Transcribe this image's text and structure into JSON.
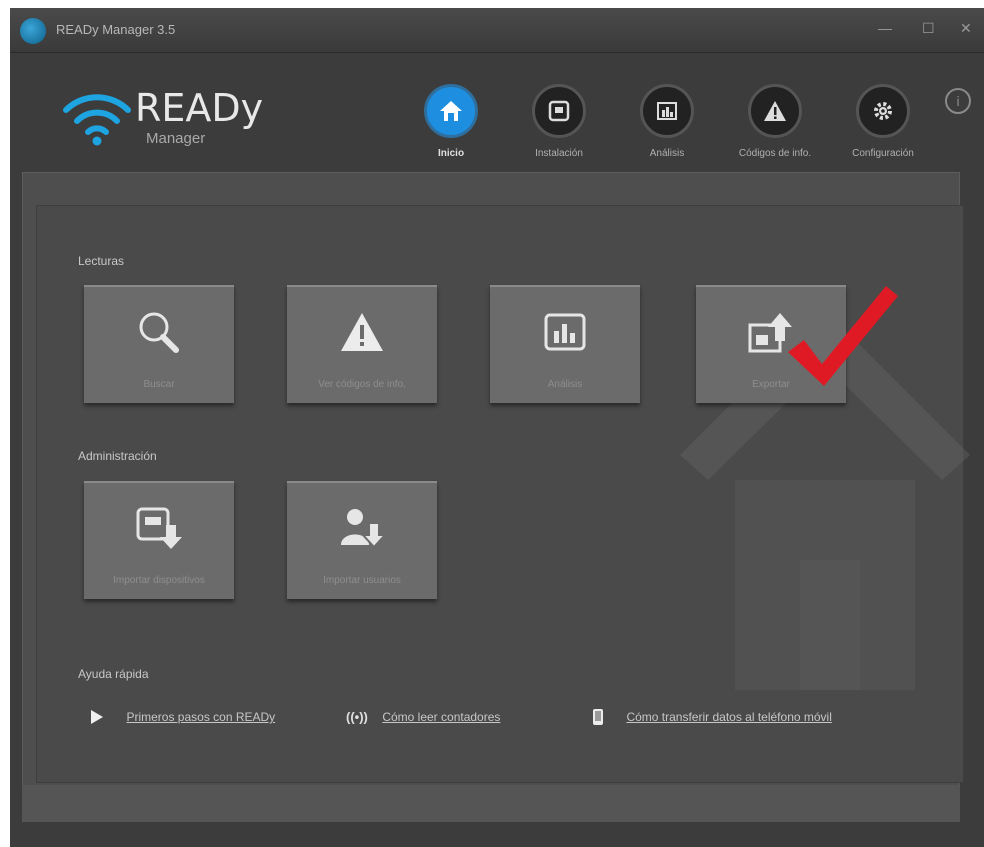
{
  "window": {
    "title": "READy Manager 3.5",
    "controls": [
      "—",
      "☐",
      "✕"
    ]
  },
  "logo": {
    "title": "READy",
    "subtitle": "Manager"
  },
  "nav": [
    {
      "label": "Inicio",
      "icon": "home-icon",
      "active": true
    },
    {
      "label": "Instalación",
      "icon": "meter-icon",
      "active": false
    },
    {
      "label": "Análisis",
      "icon": "chart-icon",
      "active": false
    },
    {
      "label": "Códigos de info.",
      "icon": "warning-icon",
      "active": false
    },
    {
      "label": "Configuración",
      "icon": "gear-icon",
      "active": false
    }
  ],
  "sections": {
    "lecturas": "Lecturas",
    "administracion": "Administración",
    "ayuda": "Ayuda rápida"
  },
  "tiles_lecturas": [
    {
      "label": "Buscar",
      "icon": "search-icon"
    },
    {
      "label": "Ver códigos de info.",
      "icon": "warning-icon"
    },
    {
      "label": "Análisis",
      "icon": "chart-icon"
    },
    {
      "label": "Exportar",
      "icon": "export-icon"
    }
  ],
  "tiles_admin": [
    {
      "label": "Importar dispositivos",
      "icon": "import-devices-icon"
    },
    {
      "label": "Importar usuarios",
      "icon": "import-users-icon"
    }
  ],
  "quick_links": [
    {
      "label": "Primeros pasos con READy",
      "icon": "play-icon"
    },
    {
      "label": "Cómo leer contadores",
      "icon": "signal-icon"
    },
    {
      "label": "Cómo transferir datos al teléfono móvil",
      "icon": "phone-icon"
    }
  ],
  "colors": {
    "accent": "#1e8fe0",
    "check": "#e01a24",
    "background": "#3c3c3c"
  }
}
